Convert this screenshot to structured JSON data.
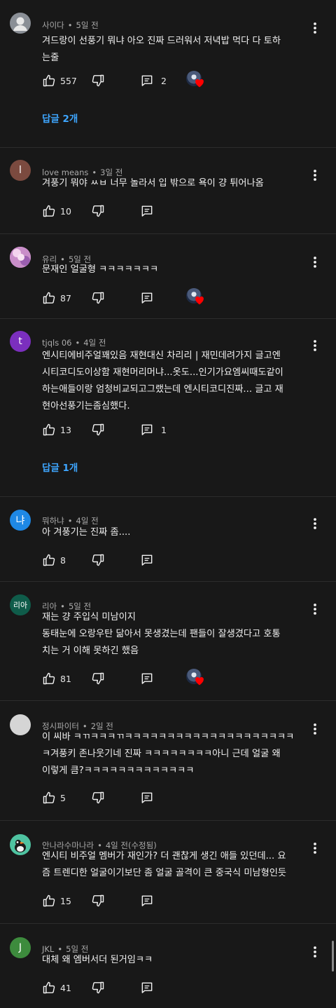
{
  "comments": [
    {
      "author": "사이다",
      "time": "5일 전",
      "avatar": {
        "letter": "",
        "color": "#8a8f96",
        "kind": "default-person"
      },
      "lines": [
        "겨드랑이 선풍기 뭐냐 아오 진짜 드러워서 저녁밥 먹다 다 토하",
        "는줄"
      ],
      "likes": "557",
      "reply_count": "2",
      "creator_heart": true,
      "replies_label": "답글 2개"
    },
    {
      "author": "love means",
      "time": "3일 전",
      "avatar": {
        "letter": "l",
        "color": "#7b4a3f",
        "kind": "letter"
      },
      "lines": [
        "겨풍기 뭐야 ㅆㅂ 너무 놀라서 입 밖으로 욕이 걍 튀어나옴"
      ],
      "likes": "10",
      "reply_count": "",
      "creator_heart": false,
      "replies_label": ""
    },
    {
      "author": "유리",
      "time": "5일 전",
      "avatar": {
        "letter": "",
        "color": "#d79bd0",
        "kind": "photo"
      },
      "lines": [
        "문재인 얼굴형 ㅋㅋㅋㅋㅋㅋㅋ"
      ],
      "likes": "87",
      "reply_count": "",
      "creator_heart": true,
      "replies_label": ""
    },
    {
      "author": "tjqls 06",
      "time": "4일 전",
      "avatar": {
        "letter": "t",
        "color": "#7b2fbe",
        "kind": "letter"
      },
      "lines": [
        "엔시티에비주얼꽤있음 재현대신 차리리 | 재민데려가지  글고엔",
        "시티코디도이상함 재현머리머냐...옷도...인기가요엠씨때도같이",
        "하는애들이랑 엄청비교되고그랬는데 엔시티코디진짜...  글고 재",
        "현아선풍기는좀심했다."
      ],
      "likes": "13",
      "reply_count": "1",
      "creator_heart": false,
      "replies_label": "답글 1개"
    },
    {
      "author": "뭐하냐",
      "time": "4일 전",
      "avatar": {
        "letter": "냐",
        "color": "#1e88e5",
        "kind": "letter"
      },
      "lines": [
        "아 겨풍기는 진짜 좀...."
      ],
      "likes": "8",
      "reply_count": "",
      "creator_heart": false,
      "replies_label": ""
    },
    {
      "author": "리아",
      "time": "5일 전",
      "avatar": {
        "letter": "리아",
        "color": "#0f5c4a",
        "kind": "letter"
      },
      "lines": [
        "재는 걍 주입식 미남이지",
        "동태눈에 오랑우탄 닮아서 못생겼는데 팬들이 잘생겼다고 호통",
        "치는 거 이해 못하긴 했음"
      ],
      "likes": "81",
      "reply_count": "",
      "creator_heart": true,
      "replies_label": ""
    },
    {
      "author": "정시파이터",
      "time": "2일 전",
      "avatar": {
        "letter": "",
        "color": "#d5d5d5",
        "kind": "blank"
      },
      "lines": [
        "이 씨바 ㅋㄲㅋㅋㅋㄲㅋㅋㅋㅋㅋㅋㅋㅋㅋㅋㅋㅋㅋㅋㅋㅋㅋㅋㅋㅋ",
        "ㅋ겨풍키 존나웃기네 진짜 ㅋㅋㅋㅋㅋㅋㅋㅋ아니 근데 얼굴 왜",
        "이렇게 큼?ㅋㅋㅋㅋㅋㅋㅋㅋㅋㅋㅋㅋㅋ"
      ],
      "likes": "5",
      "reply_count": "",
      "creator_heart": false,
      "replies_label": ""
    },
    {
      "author": "안나라수마나라",
      "time": "4일 전(수정됨)",
      "avatar": {
        "letter": "",
        "color": "#4fc3a1",
        "kind": "bird"
      },
      "lines": [
        "엔시티 비주얼 멤버가 재인가? 더 괜찮게 생긴 애들 있던데... 요",
        "즘 트렌디한 얼굴이기보단 좀 얼굴 골격이 큰 중국식 미남형인듯"
      ],
      "likes": "15",
      "reply_count": "",
      "creator_heart": false,
      "replies_label": ""
    },
    {
      "author": "JKL",
      "time": "5일 전",
      "avatar": {
        "letter": "J",
        "color": "#3d8b3d",
        "kind": "letter"
      },
      "lines": [
        "대체 왜 엠버서더 된거임ㅋㅋ"
      ],
      "likes": "41",
      "reply_count": "",
      "creator_heart": false,
      "replies_label": ""
    }
  ],
  "meta_separator": "•",
  "icons": {
    "like": "thumb-up-icon",
    "dislike": "thumb-down-icon",
    "reply": "reply-icon",
    "more": "more-vert-icon",
    "heart": "creator-heart-icon"
  },
  "colors": {
    "background": "#181818",
    "link": "#3ea6ff",
    "heart": "#ff0000"
  }
}
